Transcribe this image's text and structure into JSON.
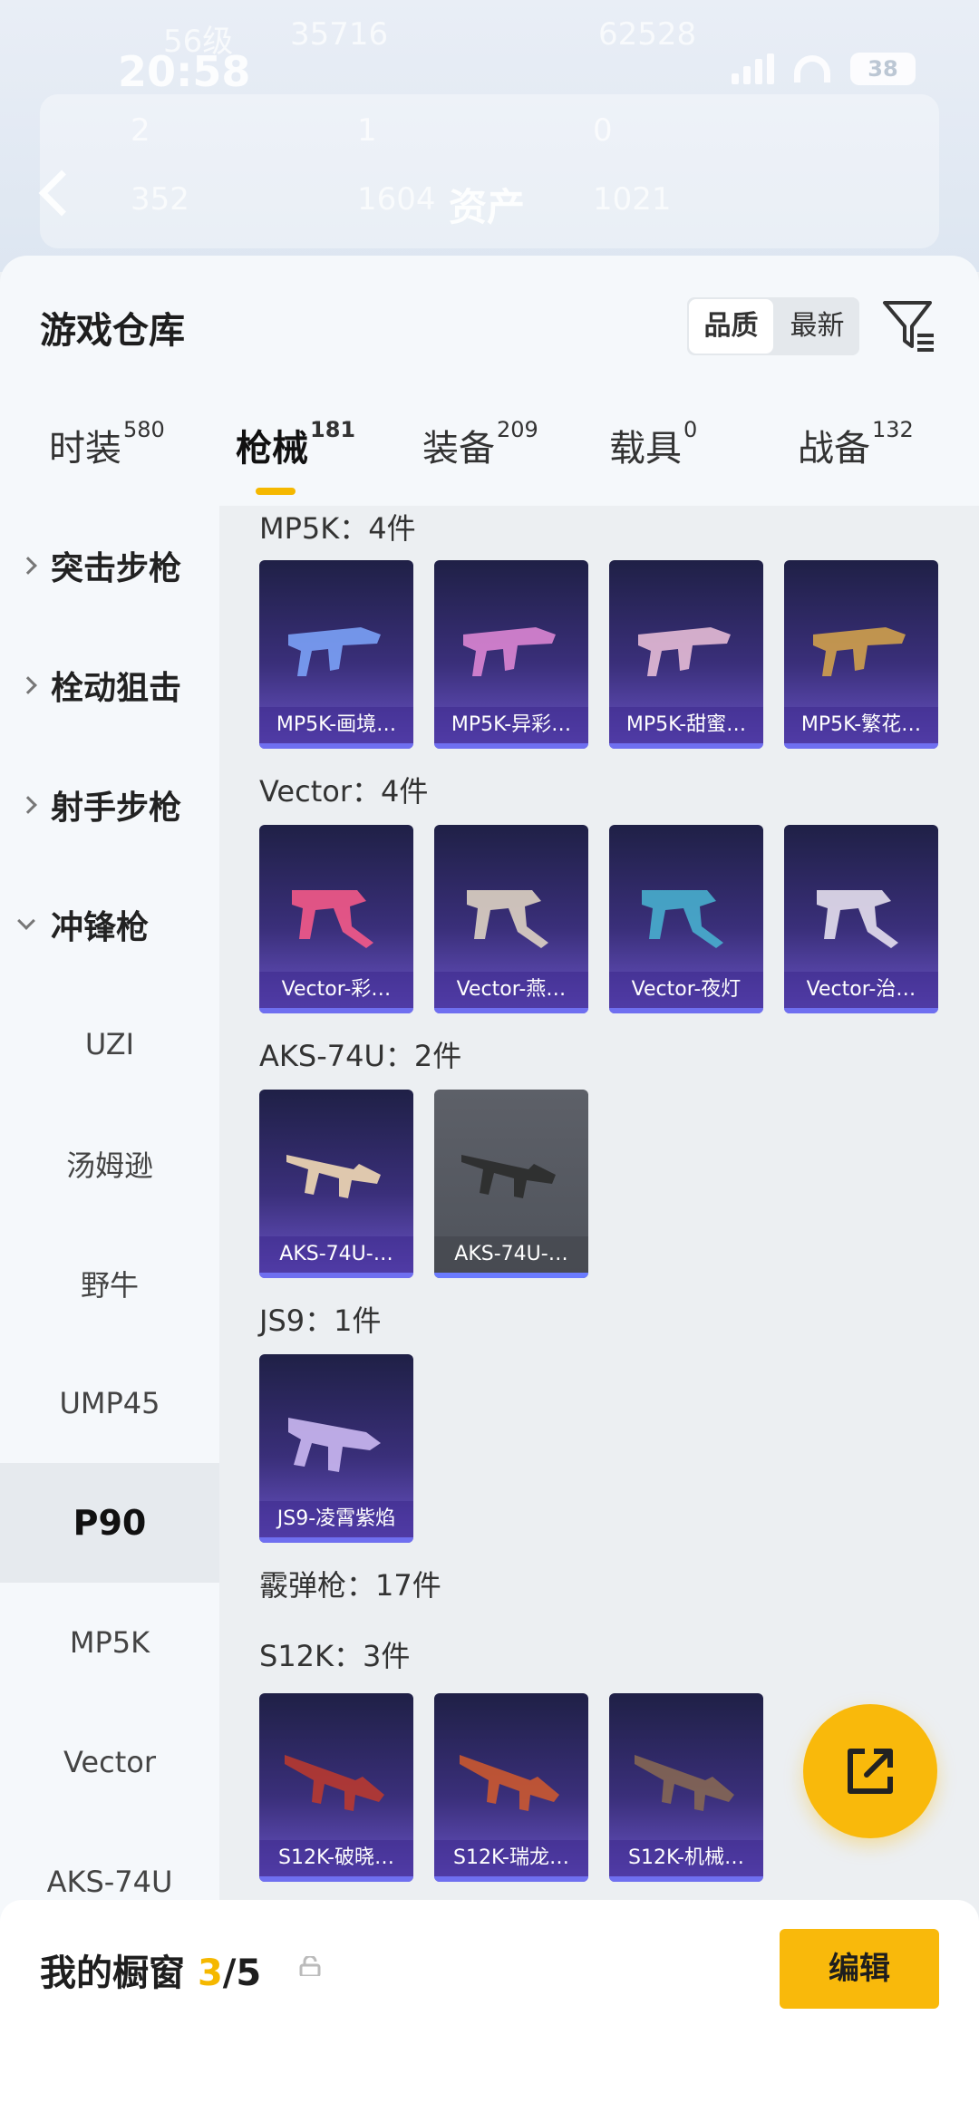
{
  "status": {
    "time": "20:58",
    "battery": "38"
  },
  "header": {
    "title": "资产",
    "blurred_level": "56级",
    "blurred_stat1": "35716",
    "blurred_stat2": "62528",
    "blurred_a": "2",
    "blurred_b": "1",
    "blurred_c": "0",
    "blurred_d": "352",
    "blurred_e": "1604",
    "blurred_f": "1021"
  },
  "sheet": {
    "title": "游戏仓库",
    "sort": {
      "quality": "品质",
      "newest": "最新"
    }
  },
  "tabs": [
    {
      "label": "时装",
      "count": "580"
    },
    {
      "label": "枪械",
      "count": "181"
    },
    {
      "label": "装备",
      "count": "209"
    },
    {
      "label": "载具",
      "count": "0"
    },
    {
      "label": "战备",
      "count": "132"
    }
  ],
  "nav": {
    "categories": [
      "突击步枪",
      "栓动狙击",
      "射手步枪",
      "冲锋枪"
    ],
    "subs": [
      "UZI",
      "汤姆逊",
      "野牛",
      "UMP45",
      "P90",
      "MP5K",
      "Vector",
      "AKS-74U"
    ],
    "selected": "P90"
  },
  "groups": [
    {
      "title": "MP5K：4件",
      "items": [
        "MP5K-画境…",
        "MP5K-异彩…",
        "MP5K-甜蜜…",
        "MP5K-繁花…"
      ]
    },
    {
      "title": "Vector：4件",
      "items": [
        "Vector-彩…",
        "Vector-燕…",
        "Vector-夜灯",
        "Vector-治…"
      ]
    },
    {
      "title": "AKS-74U：2件",
      "items": [
        "AKS-74U-…",
        "AKS-74U-…"
      ]
    },
    {
      "title": "JS9：1件",
      "items": [
        "JS9-凌霄紫焰"
      ]
    },
    {
      "title": "霰弹枪：17件"
    },
    {
      "title": "S12K：3件",
      "items": [
        "S12K-破晓…",
        "S12K-瑞龙…",
        "S12K-机械…"
      ]
    }
  ],
  "bottom": {
    "showcase_label": "我的橱窗",
    "current": "3",
    "total": "/5",
    "edit": "编辑"
  },
  "colors": {
    "accent": "#f9b90b",
    "card_top": "#1f2046",
    "card_bottom": "#6b55c9"
  }
}
